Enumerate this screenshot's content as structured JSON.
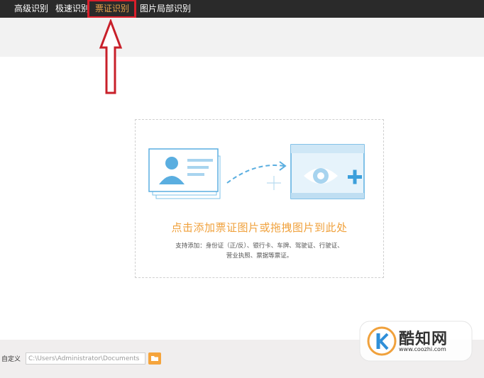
{
  "tabs": [
    {
      "label": "高级识别",
      "active": false
    },
    {
      "label": "极速识别",
      "active": false
    },
    {
      "label": "票证识别",
      "active": true
    },
    {
      "label": "图片局部识别",
      "active": false
    }
  ],
  "dropzone": {
    "title": "点击添加票证图片或拖拽图片到此处",
    "subtitle_line1": "支持添加：身份证（正/反）、银行卡、车牌、驾驶证、行驶证、",
    "subtitle_line2": "营业执照、票据等票证。"
  },
  "output": {
    "label": "自定义",
    "path": "C:\\Users\\Administrator\\Documents"
  },
  "watermark": {
    "text": "酷知网",
    "url": "www.coozhi.com"
  },
  "colors": {
    "topbar": "#2a2a2a",
    "active_tab": "#e7a14b",
    "highlight": "#d91f2b",
    "accent_blue": "#5aaee0",
    "accent_orange": "#f0a13c"
  }
}
